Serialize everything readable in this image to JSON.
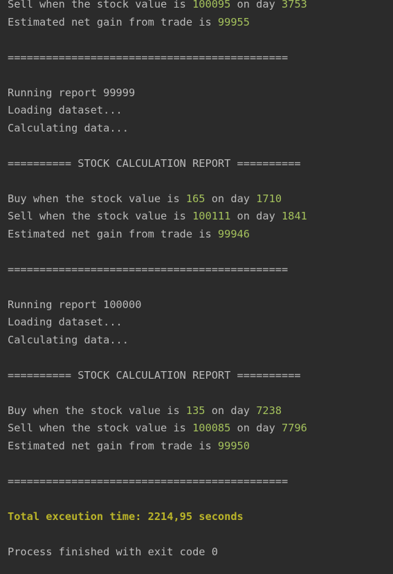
{
  "console": {
    "blocks": {
      "top": {
        "sell_prefix": "Sell when the stock value is ",
        "sell_value": "100095",
        "sell_mid": " on day ",
        "sell_day": "3753",
        "gain_prefix": "Estimated net gain from trade is ",
        "gain_value": "99955"
      },
      "separator": "============================================",
      "report1": {
        "running": "Running report 99999",
        "loading": "Loading dataset...",
        "calculating": "Calculating data...",
        "header": "========== STOCK CALCULATION REPORT ==========",
        "buy_prefix": "Buy when the stock value is ",
        "buy_value": "165",
        "buy_mid": " on day ",
        "buy_day": "1710",
        "sell_prefix": "Sell when the stock value is ",
        "sell_value": "100111",
        "sell_mid": " on day ",
        "sell_day": "1841",
        "gain_prefix": "Estimated net gain from trade is ",
        "gain_value": "99946"
      },
      "report2": {
        "running": "Running report 100000",
        "loading": "Loading dataset...",
        "calculating": "Calculating data...",
        "header": "========== STOCK CALCULATION REPORT ==========",
        "buy_prefix": "Buy when the stock value is ",
        "buy_value": "135",
        "buy_mid": " on day ",
        "buy_day": "7238",
        "sell_prefix": "Sell when the stock value is ",
        "sell_value": "100085",
        "sell_mid": " on day ",
        "sell_day": "7796",
        "gain_prefix": "Estimated net gain from trade is ",
        "gain_value": "99950"
      },
      "total_time": "Total exceution time: 2214,95 seconds",
      "exit": "Process finished with exit code 0"
    },
    "colors": {
      "background": "#2b2b2b",
      "text": "#bbbbbb",
      "number": "#a5c25c",
      "total": "#bbb529"
    }
  }
}
